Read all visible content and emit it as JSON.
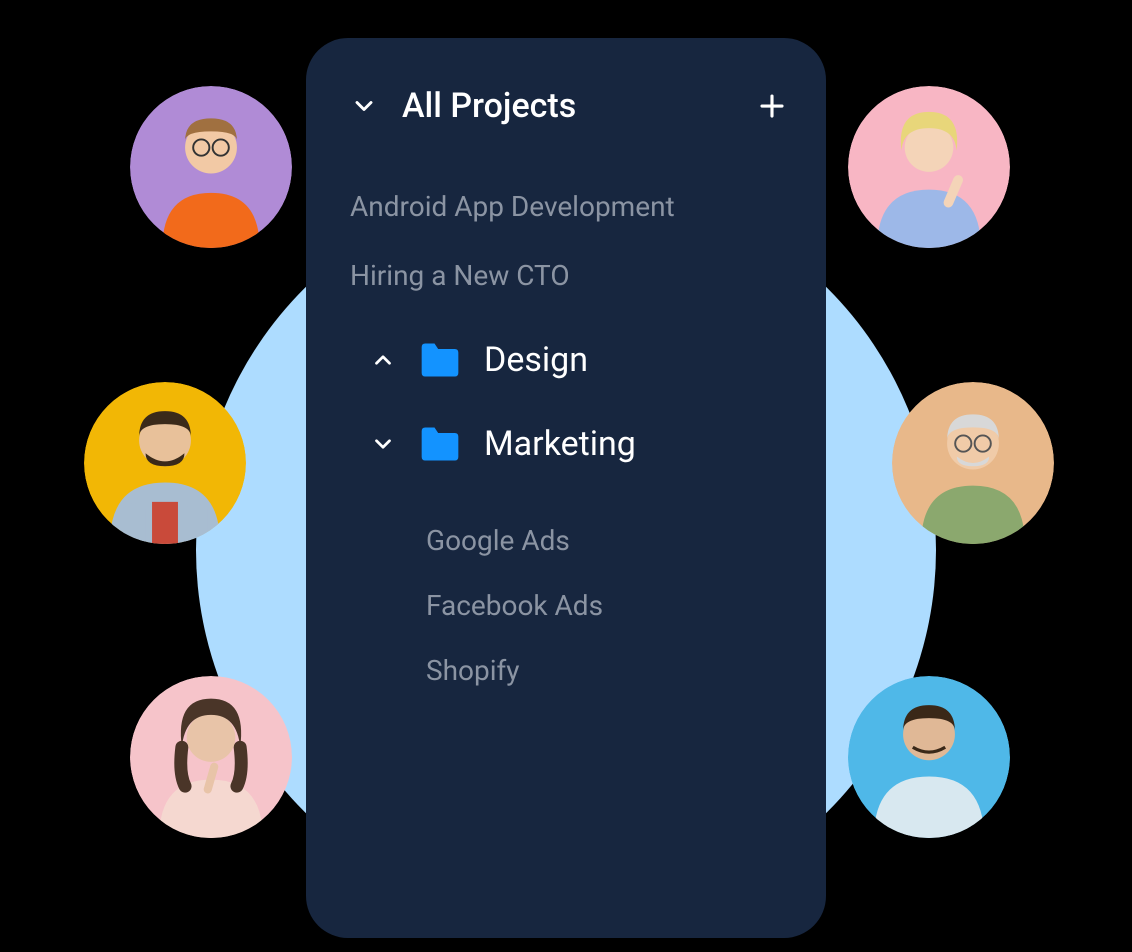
{
  "header": {
    "title": "All Projects"
  },
  "projects": [
    {
      "label": "Android App Development"
    },
    {
      "label": "Hiring a New CTO"
    }
  ],
  "folders": [
    {
      "label": "Design",
      "expanded": false
    },
    {
      "label": "Marketing",
      "expanded": true,
      "children": [
        {
          "label": "Google Ads"
        },
        {
          "label": "Facebook Ads"
        },
        {
          "label": "Shopify"
        }
      ]
    }
  ],
  "avatars": [
    {
      "bg": "#b08bd6",
      "shirt": "#f26a1b",
      "skin": "#f2c9a5",
      "hair": "#a07040"
    },
    {
      "bg": "#f8b6c4",
      "shirt": "#9db8e8",
      "skin": "#f4d4b8",
      "hair": "#e8d67a"
    },
    {
      "bg": "#f2b705",
      "shirt": "#a8bdd1",
      "skin": "#e8c19a",
      "hair": "#3a2a1a"
    },
    {
      "bg": "#e8b88a",
      "shirt": "#8ba86e",
      "skin": "#f0cba8",
      "hair": "#d8d8d8"
    },
    {
      "bg": "#f6c4ca",
      "shirt": "#f5d8d0",
      "skin": "#e8c4a8",
      "hair": "#4a3528"
    },
    {
      "bg": "#4fb8e8",
      "shirt": "#d8e8f0",
      "skin": "#e0b896",
      "hair": "#3a2818"
    }
  ],
  "colors": {
    "panel": "#17263f",
    "folder": "#1393ff",
    "muted": "#8b94a3",
    "bgCircle": "#addcff"
  }
}
